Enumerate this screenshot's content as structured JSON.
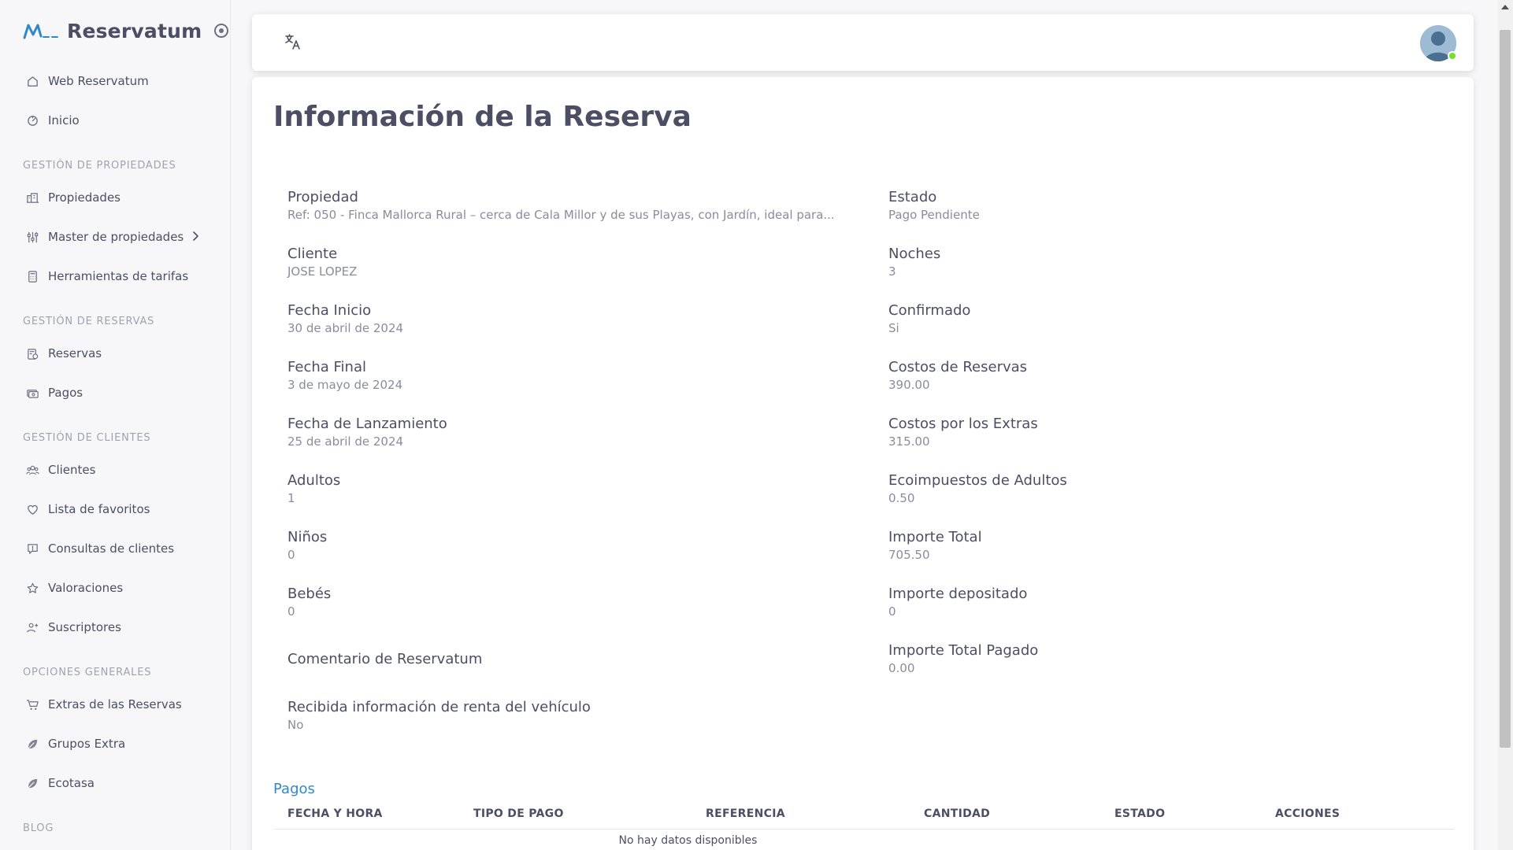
{
  "app": {
    "name": "Reservatum"
  },
  "sidebar": {
    "top_items": [
      {
        "label": "Web Reservatum",
        "icon": "home-icon"
      },
      {
        "label": "Inicio",
        "icon": "dashboard-icon"
      }
    ],
    "sections": [
      {
        "title": "GESTIÓN DE PROPIEDADES",
        "items": [
          {
            "label": "Propiedades",
            "icon": "buildings-icon"
          },
          {
            "label": "Master de propiedades",
            "icon": "sliders-icon",
            "has_submenu": true
          },
          {
            "label": "Herramientas de tarifas",
            "icon": "calculator-icon"
          }
        ]
      },
      {
        "title": "GESTIÓN DE RESERVAS",
        "items": [
          {
            "label": "Reservas",
            "icon": "calendar-icon"
          },
          {
            "label": "Pagos",
            "icon": "cash-icon"
          }
        ]
      },
      {
        "title": "GESTIÓN DE CLIENTES",
        "items": [
          {
            "label": "Clientes",
            "icon": "users-icon"
          },
          {
            "label": "Lista de favoritos",
            "icon": "heart-icon"
          },
          {
            "label": "Consultas de clientes",
            "icon": "message-icon"
          },
          {
            "label": "Valoraciones",
            "icon": "star-icon"
          },
          {
            "label": "Suscriptores",
            "icon": "subscribers-icon"
          }
        ]
      },
      {
        "title": "OPCIONES GENERALES",
        "items": [
          {
            "label": "Extras de las Reservas",
            "icon": "cart-icon"
          },
          {
            "label": "Grupos Extra",
            "icon": "leaf-icon"
          },
          {
            "label": "Ecotasa",
            "icon": "leaf-icon"
          }
        ]
      },
      {
        "title": "BLOG",
        "items": []
      }
    ]
  },
  "topbar": {
    "translate_icon": "translate-icon",
    "avatar_status": "online"
  },
  "main": {
    "title": "Información de la Reserva",
    "left_fields": [
      {
        "label": "Propiedad",
        "value": "Ref: 050 - Finca Mallorca Rural – cerca de Cala Millor y de sus Playas, con Jardín, ideal para..."
      },
      {
        "label": "Cliente",
        "value": "JOSE LOPEZ"
      },
      {
        "label": "Fecha Inicio",
        "value": "30 de abril de 2024"
      },
      {
        "label": "Fecha Final",
        "value": "3 de mayo de 2024"
      },
      {
        "label": "Fecha de Lanzamiento",
        "value": "25 de abril de 2024"
      },
      {
        "label": "Adultos",
        "value": "1"
      },
      {
        "label": "Niños",
        "value": "0"
      },
      {
        "label": "Bebés",
        "value": "0"
      },
      {
        "label": "Comentario de Reservatum",
        "value": ""
      },
      {
        "label": "Recibida información de renta del vehículo",
        "value": "No"
      }
    ],
    "right_fields": [
      {
        "label": "Estado",
        "value": "Pago Pendiente"
      },
      {
        "label": "Noches",
        "value": "3"
      },
      {
        "label": "Confirmado",
        "value": "Si"
      },
      {
        "label": "Costos de Reservas",
        "value": "390.00"
      },
      {
        "label": "Costos por los Extras",
        "value": "315.00"
      },
      {
        "label": "Ecoimpuestos de Adultos",
        "value": "0.50"
      },
      {
        "label": "Importe Total",
        "value": "705.50"
      },
      {
        "label": "Importe depositado",
        "value": "0"
      },
      {
        "label": "Importe Total Pagado",
        "value": "0.00"
      }
    ],
    "payments": {
      "title": "Pagos",
      "columns": [
        "FECHA Y HORA",
        "TIPO DE PAGO",
        "REFERENCIA",
        "CANTIDAD",
        "ESTADO",
        "ACCIONES"
      ],
      "empty_text": "No hay datos disponibles"
    }
  }
}
